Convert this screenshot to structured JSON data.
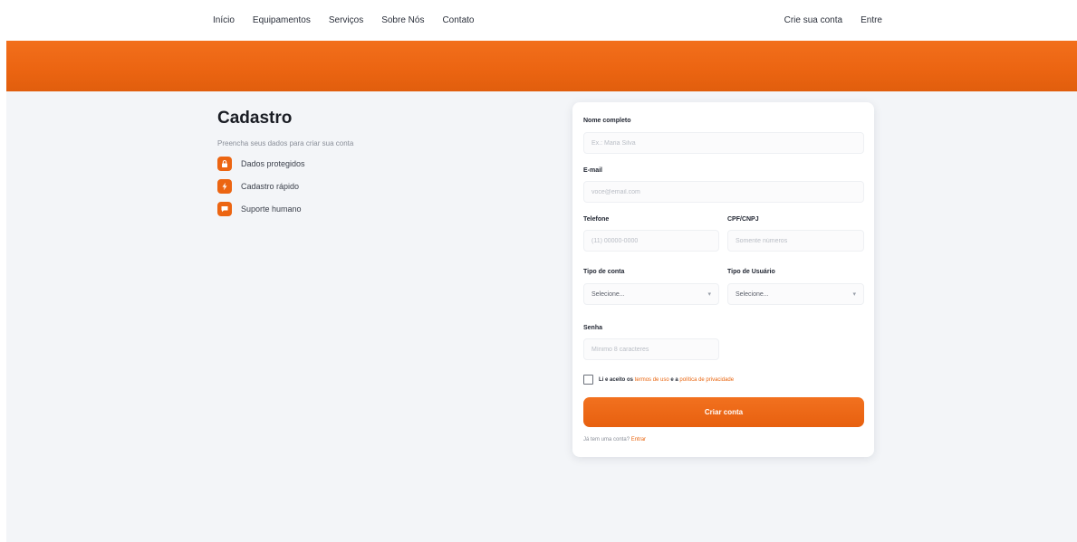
{
  "nav": {
    "items": [
      "Início",
      "Equipamentos",
      "Serviços",
      "Sobre Nós",
      "Contato"
    ],
    "register": "Crie sua conta",
    "login": "Entre"
  },
  "intro": {
    "title": "Cadastro",
    "subtitle": "Preencha seus dados para criar sua conta",
    "features": [
      {
        "label": "Dados protegidos",
        "icon": "lock-icon"
      },
      {
        "label": "Cadastro rápido",
        "icon": "lightning-icon"
      },
      {
        "label": "Suporte humano",
        "icon": "chat-icon"
      }
    ]
  },
  "form": {
    "name_label": "Nome completo",
    "name_placeholder": "Ex.: Maria Silva",
    "email_label": "E-mail",
    "email_placeholder": "voce@email.com",
    "phone_label": "Telefone",
    "phone_placeholder": "(11) 00000-0000",
    "doc_label": "CPF/CNPJ",
    "doc_placeholder": "Somente números",
    "account_type_label": "Tipo de conta",
    "account_type_value": "Selecione...",
    "user_type_label": "Tipo de Usuário",
    "user_type_value": "Selecione...",
    "password_label": "Senha",
    "password_placeholder": "Mínimo 8 caracteres",
    "terms_prefix": "Li e aceito os",
    "terms_link": "termos de uso",
    "terms_middle": "e a",
    "privacy_link": "política de privacidade",
    "terms_checked": false,
    "submit_label": "Criar conta",
    "have_account": "Já tem uma conta?",
    "login_link": "Entrar"
  },
  "colors": {
    "accent": "#ec6512",
    "background": "#f3f5f8"
  }
}
